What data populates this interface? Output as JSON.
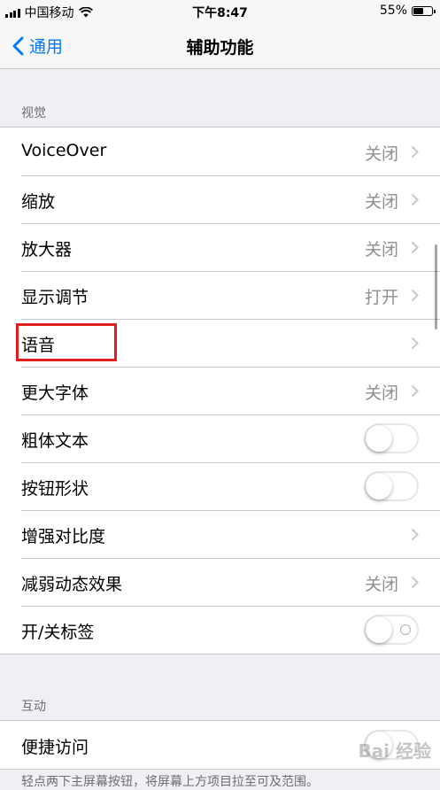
{
  "status_bar": {
    "carrier": "中国移动",
    "time": "下午8:47",
    "battery_percent": "55%",
    "battery_level": 0.55
  },
  "nav": {
    "back_label": "通用",
    "title": "辅助功能"
  },
  "vision": {
    "header": "视觉",
    "rows": [
      {
        "label": "VoiceOver",
        "value": "关闭"
      },
      {
        "label": "缩放",
        "value": "关闭"
      },
      {
        "label": "放大器",
        "value": "关闭"
      },
      {
        "label": "显示调节",
        "value": "打开"
      },
      {
        "label": "语音",
        "value": ""
      },
      {
        "label": "更大字体",
        "value": "关闭"
      },
      {
        "label": "粗体文本",
        "toggle": false
      },
      {
        "label": "按钮形状",
        "toggle": false
      },
      {
        "label": "增强对比度",
        "value": ""
      },
      {
        "label": "减弱动态效果",
        "value": "关闭"
      },
      {
        "label": "开/关标签",
        "toggle": false
      }
    ]
  },
  "interaction": {
    "header": "互动",
    "rows": [
      {
        "label": "便捷访问",
        "toggle": false
      }
    ]
  },
  "footer_text": "轻点两下主屏幕按钮，将屏幕上方项目拉至可及范围。",
  "watermark": "Bai 经验",
  "colors": {
    "accent": "#007aff",
    "highlight": "#e02020",
    "background": "#efeff4"
  }
}
